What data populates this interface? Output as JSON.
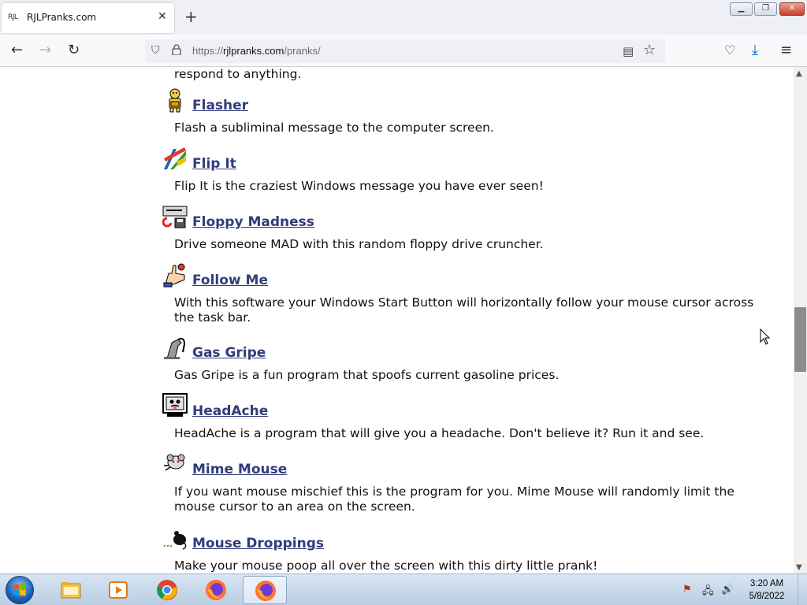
{
  "browser": {
    "tab": {
      "favicon_text": "RJL",
      "title": "RJLPranks.com"
    },
    "url": {
      "scheme": "https://",
      "host": "rjlpranks.com",
      "path": "/pranks/"
    }
  },
  "page": {
    "top_partial_text": "respond to anything.",
    "pranks": [
      {
        "name": "Flasher",
        "description": "Flash a subliminal message to the computer screen.",
        "icon": "cartoon-man-icon"
      },
      {
        "name": "Flip It",
        "description": "Flip It is the craziest Windows message you have ever seen!",
        "icon": "flip-window-icon"
      },
      {
        "name": "Floppy Madness",
        "description": "Drive someone MAD with this random floppy drive cruncher.",
        "icon": "floppy-drive-icon"
      },
      {
        "name": "Follow Me",
        "description": "With this software your Windows Start Button will horizontally follow your mouse cursor across the task bar.",
        "icon": "pointing-hand-icon"
      },
      {
        "name": "Gas Gripe",
        "description": "Gas Gripe is a fun program that spoofs current gasoline prices.",
        "icon": "gas-pump-icon"
      },
      {
        "name": "HeadAche",
        "description": "HeadAche is a program that will give you a headache. Don't believe it? Run it and see.",
        "icon": "monitor-face-icon"
      },
      {
        "name": "Mime Mouse",
        "description": "If you want mouse mischief this is the program for you. Mime Mouse will randomly limit the mouse cursor to an area on the screen.",
        "icon": "mime-mouse-icon"
      },
      {
        "name": "Mouse Droppings",
        "description": "Make your mouse poop all over the screen with this dirty little prank!",
        "icon": "mouse-droppings-icon"
      }
    ]
  },
  "taskbar": {
    "clock_time": "3:20 AM",
    "clock_date": "5/8/2022",
    "apps": [
      "file-explorer-icon",
      "media-player-icon",
      "chrome-icon",
      "firefox-icon",
      "firefox-icon"
    ]
  }
}
